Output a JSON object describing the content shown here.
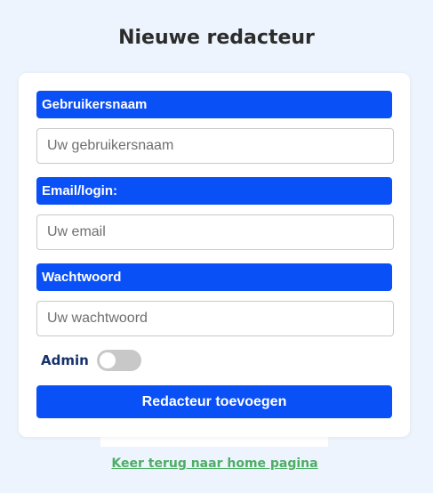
{
  "page": {
    "title": "Nieuwe redacteur"
  },
  "form": {
    "username": {
      "label": "Gebruikersnaam",
      "placeholder": "Uw gebruikersnaam",
      "value": ""
    },
    "email": {
      "label": "Email/login:",
      "placeholder": "Uw email",
      "value": ""
    },
    "password": {
      "label": "Wachtwoord",
      "placeholder": "Uw wachtwoord",
      "value": ""
    },
    "admin": {
      "label": "Admin",
      "checked": false
    },
    "submit_label": "Redacteur toevoegen"
  },
  "footer": {
    "home_link": "Keer terug naar home pagina"
  },
  "colors": {
    "accent": "#0a50f7",
    "background": "#eef4fd",
    "link": "#4cae64",
    "toggle_off": "#c8c8c8"
  }
}
